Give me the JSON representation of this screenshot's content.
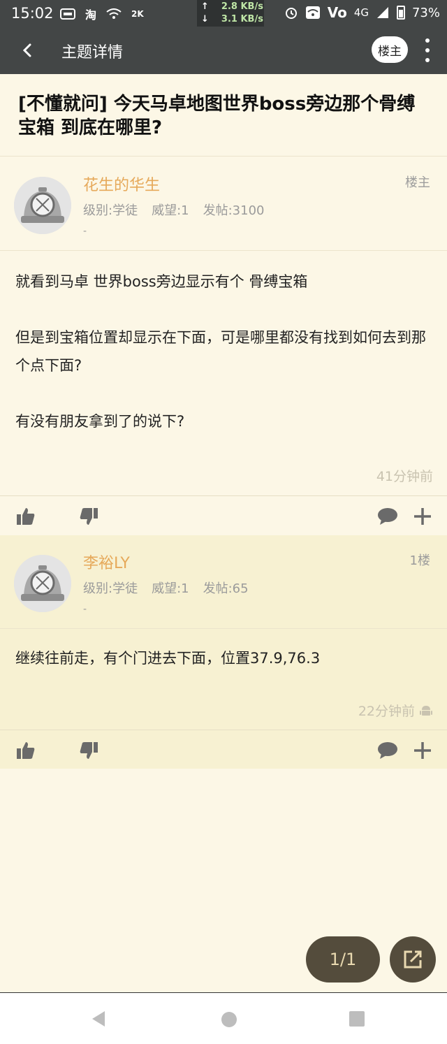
{
  "status_bar": {
    "time": "15:02",
    "left_icons": [
      "message-icon",
      "taobao-icon",
      "wifi-icon",
      "2k-icon"
    ],
    "taobao_label": "淘",
    "k_label": "2K",
    "speed_up": "2.8 KB/s",
    "speed_down": "3.1 KB/s",
    "volte": "Vo",
    "network": "4G",
    "battery": "73%"
  },
  "appbar": {
    "title": "主题详情",
    "op_button": "楼主"
  },
  "topic": {
    "title": "[不懂就问] 今天马卓地图世界boss旁边那个骨缚宝箱 到底在哪里?"
  },
  "posts": [
    {
      "username": "花生的华生",
      "level": "级别:学徒",
      "prestige": "威望:1",
      "post_count": "发帖:3100",
      "dash": "-",
      "floor": "楼主",
      "paragraphs": [
        "就看到马卓 世界boss旁边显示有个 骨缚宝箱",
        "但是到宝箱位置却显示在下面，可是哪里都没有找到如何去到那个点下面?",
        "有没有朋友拿到了的说下?"
      ],
      "time": "41分钟前"
    },
    {
      "username": "李裕LY",
      "level": "级别:学徒",
      "prestige": "威望:1",
      "post_count": "发帖:65",
      "dash": "-",
      "floor": "1楼",
      "paragraphs": [
        "继续往前走，有个门进去下面，位置37.9,76.3"
      ],
      "time": "22分钟前",
      "device_icon": "android-icon"
    }
  ],
  "pager": {
    "label": "1/1"
  },
  "colors": {
    "bar": "#434646",
    "background": "#fcf7e6",
    "reply_background": "#f7f1d2",
    "username": "#e6a95a",
    "float_button": "#544c3c"
  }
}
